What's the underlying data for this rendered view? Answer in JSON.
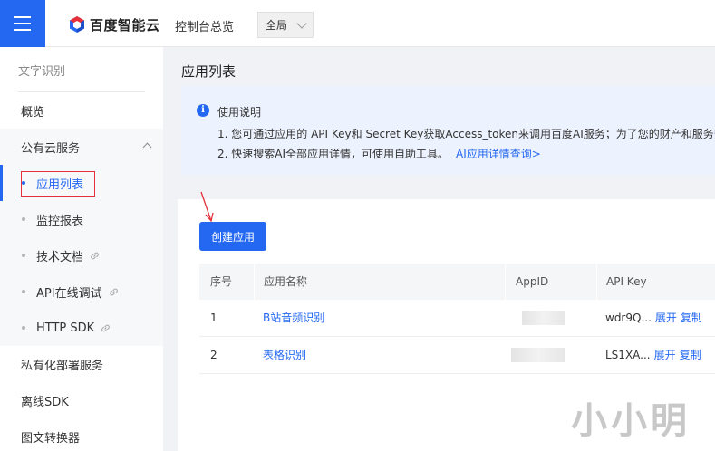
{
  "header": {
    "brand": "百度智能云",
    "console_link": "控制台总览",
    "region": "全局"
  },
  "sidebar": {
    "product": "文字识别",
    "items": [
      {
        "label": "概览"
      },
      {
        "label": "公有云服务"
      },
      {
        "label": "应用列表"
      },
      {
        "label": "监控报表"
      },
      {
        "label": "技术文档"
      },
      {
        "label": "API在线调试"
      },
      {
        "label": "HTTP SDK"
      },
      {
        "label": "私有化部署服务"
      },
      {
        "label": "离线SDK"
      },
      {
        "label": "图文转换器"
      }
    ]
  },
  "main": {
    "title": "应用列表",
    "notice": {
      "head": "使用说明",
      "line1": "1. 您可通过应用的 API Key和 Secret Key获取Access_token来调用百度AI服务；为了您的财产和服务安全",
      "line2": "2. 快速搜索AI全部应用详情，可使用自助工具。",
      "line2_link": "AI应用详情查询>"
    },
    "create_button": "创建应用",
    "table": {
      "headers": [
        "序号",
        "应用名称",
        "AppID",
        "API Key"
      ],
      "rows": [
        {
          "index": "1",
          "name": "B站音频识别",
          "api_key": "wdr9Q...",
          "expand": "展开",
          "copy": "复制"
        },
        {
          "index": "2",
          "name": "表格识别",
          "api_key": "LS1XA...",
          "expand": "展开",
          "copy": "复制"
        }
      ]
    }
  },
  "watermark": "小小明",
  "colors": {
    "accent": "#2468f2",
    "highlight_box": "#e5303a",
    "notice_bg": "#edf3fe"
  }
}
